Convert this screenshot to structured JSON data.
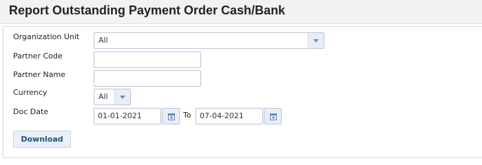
{
  "page": {
    "title": "Report Outstanding Payment Order Cash/Bank"
  },
  "form": {
    "org_unit": {
      "label": "Organization Unit",
      "value": "All"
    },
    "partner_code": {
      "label": "Partner Code",
      "value": ""
    },
    "partner_name": {
      "label": "Partner Name",
      "value": ""
    },
    "currency": {
      "label": "Currency",
      "value": "All"
    },
    "doc_date": {
      "label": "Doc Date",
      "from": "01-01-2021",
      "to_label": "To",
      "to": "07-04-2021"
    }
  },
  "actions": {
    "download_label": "Download"
  },
  "icons": {
    "dropdown": "chevron-down-icon",
    "calendar": "calendar-icon"
  }
}
